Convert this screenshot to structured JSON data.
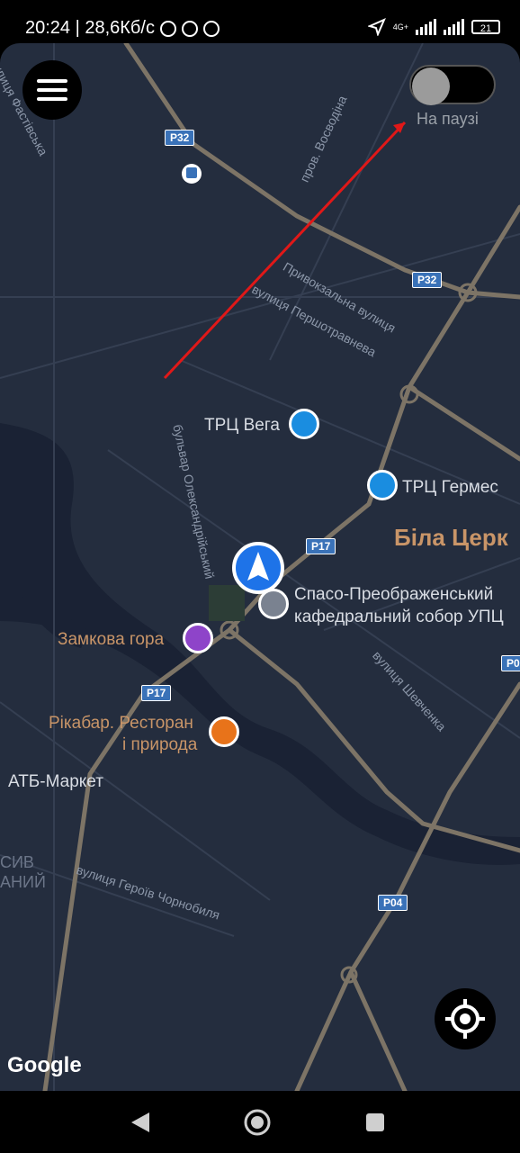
{
  "status": {
    "time_speed": "20:24 | 28,6Кб/с",
    "network": "4G+",
    "battery": "21"
  },
  "controls": {
    "toggle_label": "На паузі",
    "menu_icon": "hamburger-menu-icon",
    "locate_icon": "my-location-icon"
  },
  "map": {
    "google_logo": "Google",
    "city_label": "Біла Церк",
    "places": {
      "vega": "ТРЦ Вега",
      "hermes": "ТРЦ Гермес",
      "cathedral_line1": "Спасо-Преображенський",
      "cathedral_line2": "кафедральний собор УПЦ",
      "castle": "Замкова гора",
      "rikabar_line1": "Рікабар. Ресторан",
      "rikabar_line2": "і природа",
      "atb": "АТБ-Маркет"
    },
    "streets": {
      "fastivska": "вулиця Фастівська",
      "vosvodina": "пров. Восводіна",
      "pryvokzalna": "Привокзальна вулиця",
      "pershotravneva": "вулиця Першотравнева",
      "oleksandriiskyi": "бульвар Олександрійський",
      "shevchenka": "вулиця Шевченка",
      "heroiv": "вулиця Героїв Чорнобиля"
    },
    "shields": {
      "p32a": "P32",
      "p32b": "P32",
      "p17a": "P17",
      "p17b": "P17",
      "p04": "P04",
      "p0": "P0"
    },
    "district": {
      "line1": "СИВ",
      "line2": "АНИЙ"
    }
  },
  "colors": {
    "map_bg": "#242d3e",
    "road": "#7d7466",
    "route_arrow": "#e01818",
    "place_label": "#c99568",
    "shopping_pin": "#1a8de0",
    "castle_pin": "#8e44c9",
    "restaurant_pin": "#e8731a",
    "nav_marker": "#1e73e8"
  }
}
